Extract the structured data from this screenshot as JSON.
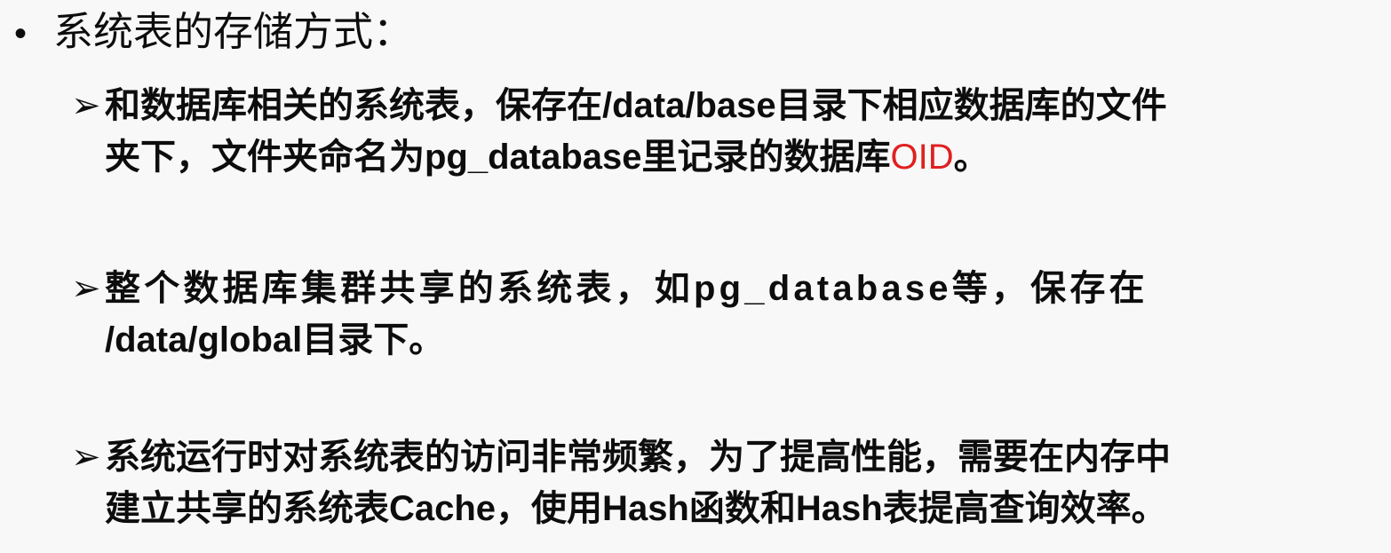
{
  "heading": {
    "bullet": "•",
    "text": "系统表的存储方式："
  },
  "items": [
    {
      "arrow": "➢",
      "line1": "和数据库相关的系统表，保存在/data/base目录下相应数据库的文件",
      "line2_prefix": "夹下，文件夹命名为pg_database里记录的数据库",
      "line2_highlight": "OID",
      "line2_suffix": "。"
    },
    {
      "arrow": "➢",
      "line1": "整个数据库集群共享的系统表，如pg_database等，保存在",
      "line2": "/data/global目录下。"
    },
    {
      "arrow": "➢",
      "line1": "系统运行时对系统表的访问非常频繁，为了提高性能，需要在内存中",
      "line2": "建立共享的系统表Cache，使用Hash函数和Hash表提高查询效率。"
    }
  ],
  "colors": {
    "text": "#0d0d0d",
    "highlight": "#e02020",
    "background": "#f8f8f8"
  }
}
